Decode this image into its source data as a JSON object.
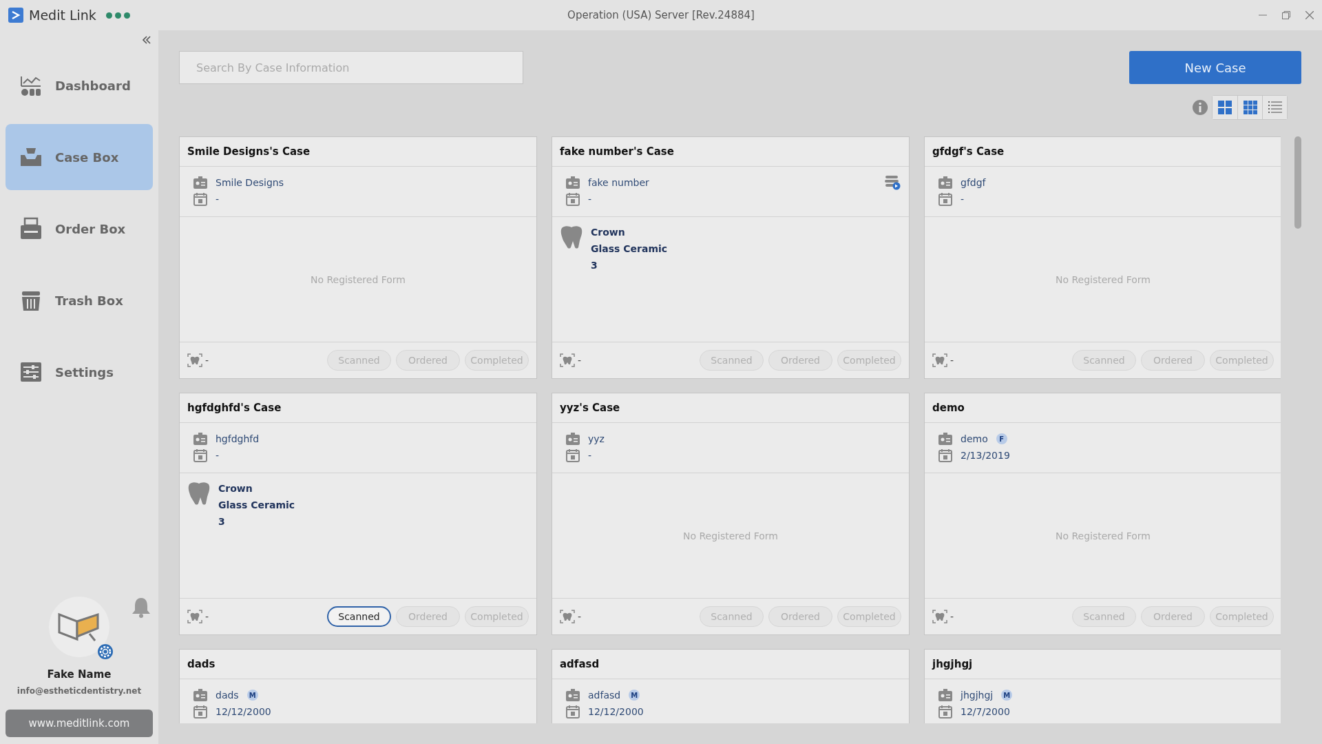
{
  "window": {
    "app_name": "Medit Link",
    "title": "Operation (USA) Server [Rev.24884]"
  },
  "sidebar": {
    "items": [
      {
        "label": "Dashboard",
        "selected": false
      },
      {
        "label": "Case Box",
        "selected": true
      },
      {
        "label": "Order Box",
        "selected": false
      },
      {
        "label": "Trash Box",
        "selected": false
      },
      {
        "label": "Settings",
        "selected": false
      }
    ],
    "user": {
      "name": "Fake Name",
      "email": "info@estheticdentistry.net"
    },
    "website": "www.meditlink.com"
  },
  "search": {
    "placeholder": "Search By Case Information"
  },
  "new_case_button": "New Case",
  "cards": [
    {
      "title": "Smile Designs's Case",
      "patient": "Smile Designs",
      "date": "-",
      "synced": false,
      "empty_text": "No Registered Form",
      "scan": "-",
      "status": [
        {
          "label": "Scanned",
          "selected": false
        },
        {
          "label": "Ordered",
          "selected": false
        },
        {
          "label": "Completed",
          "selected": false
        }
      ]
    },
    {
      "title": "fake number's Case",
      "patient": "fake number",
      "date": "-",
      "synced": true,
      "form": {
        "type": "Crown",
        "material": "Glass Ceramic",
        "tooth": "3"
      },
      "scan": "-",
      "status": [
        {
          "label": "Scanned",
          "selected": false
        },
        {
          "label": "Ordered",
          "selected": false
        },
        {
          "label": "Completed",
          "selected": false
        }
      ]
    },
    {
      "title": "gfdgf's Case",
      "patient": "gfdgf",
      "date": "-",
      "synced": false,
      "empty_text": "No Registered Form",
      "scan": "-",
      "status": [
        {
          "label": "Scanned",
          "selected": false
        },
        {
          "label": "Ordered",
          "selected": false
        },
        {
          "label": "Completed",
          "selected": false
        }
      ]
    },
    {
      "title": "hgfdghfd's Case",
      "patient": "hgfdghfd",
      "date": "-",
      "synced": false,
      "form": {
        "type": "Crown",
        "material": "Glass Ceramic",
        "tooth": "3"
      },
      "scan": "-",
      "status": [
        {
          "label": "Scanned",
          "selected": true
        },
        {
          "label": "Ordered",
          "selected": false
        },
        {
          "label": "Completed",
          "selected": false
        }
      ]
    },
    {
      "title": "yyz's Case",
      "patient": "yyz",
      "date": "-",
      "synced": false,
      "empty_text": "No Registered Form",
      "scan": "-",
      "status": [
        {
          "label": "Scanned",
          "selected": false
        },
        {
          "label": "Ordered",
          "selected": false
        },
        {
          "label": "Completed",
          "selected": false
        }
      ]
    },
    {
      "title": "demo",
      "patient": "demo",
      "badge": "F",
      "date": "2/13/2019",
      "synced": false,
      "empty_text": "No Registered Form",
      "scan": "-",
      "status": [
        {
          "label": "Scanned",
          "selected": false
        },
        {
          "label": "Ordered",
          "selected": false
        },
        {
          "label": "Completed",
          "selected": false
        }
      ]
    },
    {
      "title": "dads",
      "patient": "dads",
      "badge": "M",
      "date": "12/12/2000",
      "synced": false
    },
    {
      "title": "adfasd",
      "patient": "adfasd",
      "badge": "M",
      "date": "12/12/2000",
      "synced": false
    },
    {
      "title": "jhgjhgj",
      "patient": "jhgjhgj",
      "badge": "M",
      "date": "12/7/2000",
      "synced": false
    }
  ]
}
